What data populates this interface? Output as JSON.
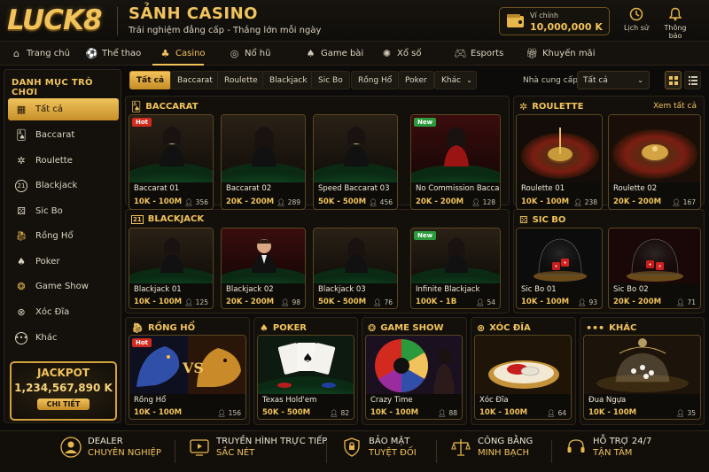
{
  "header": {
    "logo": "LUCK8",
    "title": "SẢNH CASINO",
    "subtitle": "Trải nghiệm đẳng cấp - Thắng lớn mỗi ngày",
    "wallet": {
      "label": "Ví chính",
      "balance": "10,000,000 K"
    },
    "history_label": "Lịch sử",
    "notify_label": "Thông báo"
  },
  "nav": [
    {
      "label": "Trang chủ",
      "icon": "home-icon"
    },
    {
      "label": "Thể thao",
      "icon": "sports-icon"
    },
    {
      "label": "Casino",
      "icon": "casino-icon",
      "active": true
    },
    {
      "label": "Nổ hũ",
      "icon": "slot-icon"
    },
    {
      "label": "Game bài",
      "icon": "cards-icon"
    },
    {
      "label": "Xổ số",
      "icon": "lottery-icon"
    },
    {
      "label": "Esports",
      "icon": "gamepad-icon"
    },
    {
      "label": "Khuyến mãi",
      "icon": "gift-icon"
    }
  ],
  "sidebar": {
    "title": "DANH MỤC TRÒ CHƠI",
    "items": [
      {
        "label": "Tất cả",
        "icon": "grid-icon",
        "active": true
      },
      {
        "label": "Baccarat",
        "icon": "cards-icon"
      },
      {
        "label": "Roulette",
        "icon": "roulette-icon"
      },
      {
        "label": "Blackjack",
        "icon": "blackjack-21-icon"
      },
      {
        "label": "Sic Bo",
        "icon": "dice-icon"
      },
      {
        "label": "Rồng Hổ",
        "icon": "dragon-icon"
      },
      {
        "label": "Poker",
        "icon": "spade-icon"
      },
      {
        "label": "Game Show",
        "icon": "wheel-icon"
      },
      {
        "label": "Xóc Đĩa",
        "icon": "shaker-icon"
      },
      {
        "label": "Khác",
        "icon": "more-icon"
      }
    ],
    "jackpot": {
      "title": "JACKPOT",
      "value": "1,234,567,890 K",
      "button": "CHI TIẾT"
    }
  },
  "filters": {
    "chips": [
      "Tất cả",
      "Baccarat",
      "Roulette",
      "Blackjack",
      "Sic Bo",
      "Rồng Hổ",
      "Poker",
      "Khác"
    ],
    "provider_label": "Nhà cung cấp:",
    "provider_value": "Tất cả"
  },
  "sections": {
    "baccarat": {
      "title": "BACCARAT",
      "cards": [
        {
          "name": "Baccarat 01",
          "range": "10K - 100M",
          "players": "356",
          "tag": "Hot"
        },
        {
          "name": "Baccarat 02",
          "range": "20K - 200M",
          "players": "289"
        },
        {
          "name": "Speed Baccarat 03",
          "range": "50K - 500M",
          "players": "456"
        },
        {
          "name": "No Commission Baccarat",
          "range": "20K - 200M",
          "players": "128",
          "tag": "New"
        }
      ]
    },
    "roulette": {
      "title": "ROULETTE",
      "see_all": "Xem tất cả",
      "cards": [
        {
          "name": "Roulette 01",
          "range": "10K - 100M",
          "players": "238"
        },
        {
          "name": "Roulette 02",
          "range": "20K - 200M",
          "players": "167"
        }
      ]
    },
    "blackjack": {
      "title": "BLACKJACK",
      "cards": [
        {
          "name": "Blackjack 01",
          "range": "10K - 100M",
          "players": "125"
        },
        {
          "name": "Blackjack 02",
          "range": "20K - 200M",
          "players": "98"
        },
        {
          "name": "Blackjack 03",
          "range": "50K - 500M",
          "players": "76"
        },
        {
          "name": "Infinite Blackjack",
          "range": "100K - 1B",
          "players": "54",
          "tag": "New"
        }
      ]
    },
    "sicbo": {
      "title": "SIC BO",
      "cards": [
        {
          "name": "Sic Bo 01",
          "range": "10K - 100M",
          "players": "93"
        },
        {
          "name": "Sic Bo 02",
          "range": "20K - 200M",
          "players": "71"
        }
      ]
    },
    "ronghoe": {
      "title": "RỒNG HỔ",
      "cards": [
        {
          "name": "Rồng Hổ",
          "range": "10K - 100M",
          "players": "156",
          "tag": "Hot"
        }
      ]
    },
    "poker": {
      "title": "POKER",
      "cards": [
        {
          "name": "Texas Hold'em",
          "range": "50K - 500M",
          "players": "82"
        }
      ]
    },
    "gameshow": {
      "title": "GAME SHOW",
      "cards": [
        {
          "name": "Crazy Time",
          "range": "10K - 100M",
          "players": "88"
        }
      ]
    },
    "xocdia": {
      "title": "XÓC ĐĨA",
      "cards": [
        {
          "name": "Xóc Đĩa",
          "range": "10K - 100M",
          "players": "64"
        }
      ]
    },
    "khac": {
      "title": "KHÁC",
      "cards": [
        {
          "name": "Đua Ngựa",
          "range": "10K - 100M",
          "players": "35"
        }
      ]
    }
  },
  "footer": [
    {
      "line1": "DEALER",
      "line2": "CHUYÊN NGHIỆP",
      "icon": "dealer-icon"
    },
    {
      "line1": "TRUYỀN HÌNH TRỰC TIẾP",
      "line2": "SẮC NÉT",
      "icon": "tv-icon"
    },
    {
      "line1": "BẢO MẬT",
      "line2": "TUYỆT ĐỐI",
      "icon": "shield-icon"
    },
    {
      "line1": "CÔNG BẰNG",
      "line2": "MINH BẠCH",
      "icon": "scale-icon"
    },
    {
      "line1": "HỖ TRỢ 24/7",
      "line2": "TẬN TÂM",
      "icon": "support-icon"
    }
  ],
  "colors": {
    "accent": "#f0c35c",
    "background": "#0c0b09",
    "hot": "#d22a1e",
    "new": "#2a9a3c"
  }
}
